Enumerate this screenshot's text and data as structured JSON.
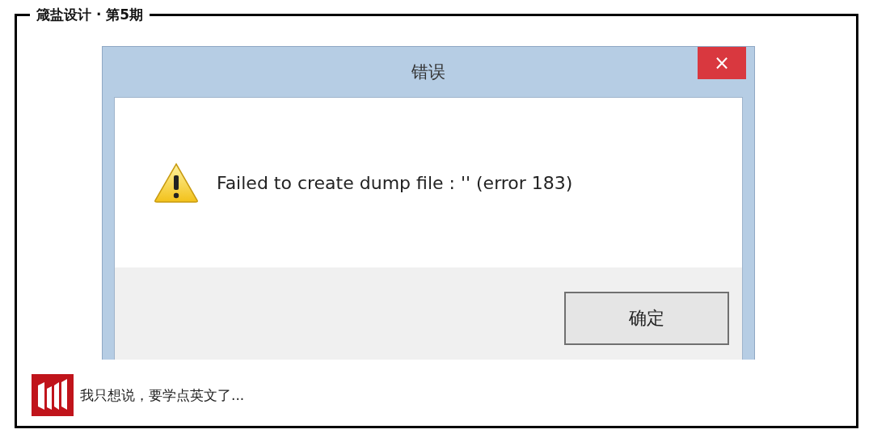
{
  "frame": {
    "title": "箴盐设计 · 第5期"
  },
  "dialog": {
    "title": "错误",
    "close": "×",
    "message": "Failed to create dump file : '' (error 183)",
    "buttons": [
      {
        "label": "确定",
        "selected": true
      }
    ]
  },
  "caption": {
    "text": "我只想说，要学点英文了..."
  }
}
